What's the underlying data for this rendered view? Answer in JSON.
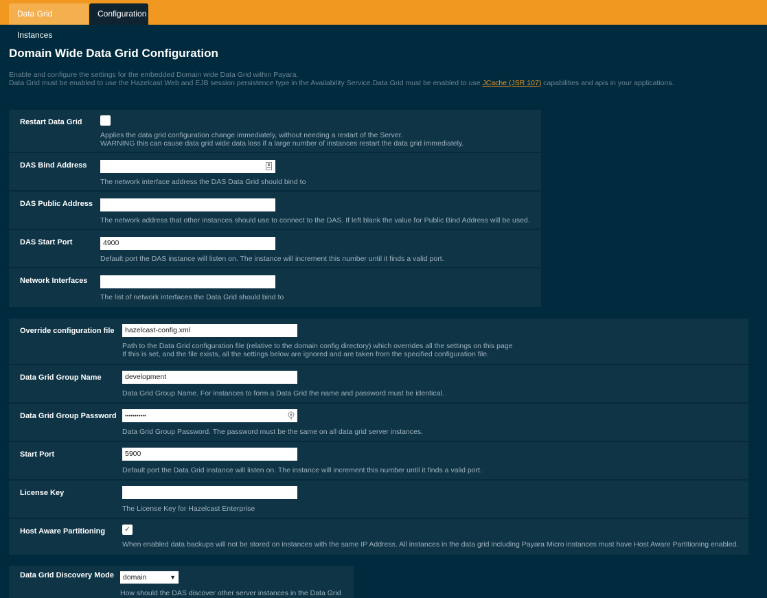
{
  "tabs": [
    {
      "label": "Data Grid Instances",
      "active": false
    },
    {
      "label": "Configuration",
      "active": true
    }
  ],
  "page": {
    "title": "Domain Wide Data Grid Configuration",
    "intro_line1": "Enable and configure the settings for the embedded Domain wide Data Grid within Payara.",
    "intro_line2_before": "Data Grid must be enabled to use the Hazelcast Web and EJB session persistence type in the Availability Service.Data Grid must be enabled to use ",
    "intro_link": "JCache (JSR 107)",
    "intro_line2_after": " capabilities and apis in your applications."
  },
  "colors": {
    "accent": "#f0981f",
    "background": "#002a3d",
    "panel": "#0e3446"
  },
  "das_panel": {
    "restart": {
      "label": "Restart Data Grid",
      "checked": false,
      "help_line1": "Applies the data grid configuration change immediately, without needing a restart of the Server.",
      "help_line2": "WARNING this can cause data grid wide data loss if a large number of instances restart the data grid immediately."
    },
    "bind_address": {
      "label": "DAS Bind Address",
      "value": "",
      "icon": "contact-card-icon",
      "help": "The network interface address the DAS Data Grid should bind to"
    },
    "public_address": {
      "label": "DAS Public Address",
      "value": "",
      "help": "The network address that other instances should use to connect to the DAS. If left blank the value for Public Bind Address will be used."
    },
    "start_port": {
      "label": "DAS Start Port",
      "value": "4900",
      "help": "Default port the DAS instance will listen on. The instance will increment this number until it finds a valid port."
    },
    "network_interfaces": {
      "label": "Network Interfaces",
      "value": "",
      "help": "The list of network interfaces the Data Grid should bind to"
    }
  },
  "grid_panel": {
    "override_config": {
      "label": "Override configuration file",
      "value": "hazelcast-config.xml",
      "help_line1": "Path to the Data Grid configuration file (relative to the domain config directory) which overrides all the settings on this page",
      "help_line2": "If this is set, and the file exists, all the settings below are ignored and are taken from the specified configuration file."
    },
    "group_name": {
      "label": "Data Grid Group Name",
      "value": "development",
      "help": "Data Grid Group Name. For instances to form a Data Grid the name and password must be identical."
    },
    "group_password": {
      "label": "Data Grid Group Password",
      "value": "•••••••••••",
      "icon": "password-key-icon",
      "help": "Data Grid Group Password. The password must be the same on all data grid server instances."
    },
    "start_port": {
      "label": "Start Port",
      "value": "5900",
      "help": "Default port the Data Grid instance will listen on. The instance will increment this number until it finds a valid port."
    },
    "license_key": {
      "label": "License Key",
      "value": "",
      "help": "The License Key for Hazelcast Enterprise"
    },
    "host_aware": {
      "label": "Host Aware Partitioning",
      "checked": true,
      "check_glyph": "✓",
      "help": "When enabled data backups will not be stored on instances with the same IP Address. All instances in the data grid including Payara Micro instances must have Host Aware Partitioning enabled."
    }
  },
  "discovery_panel": {
    "label": "Data Grid Discovery Mode",
    "selected": "domain",
    "arrow": "▼",
    "help": "How should the DAS discover other server instances in the Data Grid"
  }
}
